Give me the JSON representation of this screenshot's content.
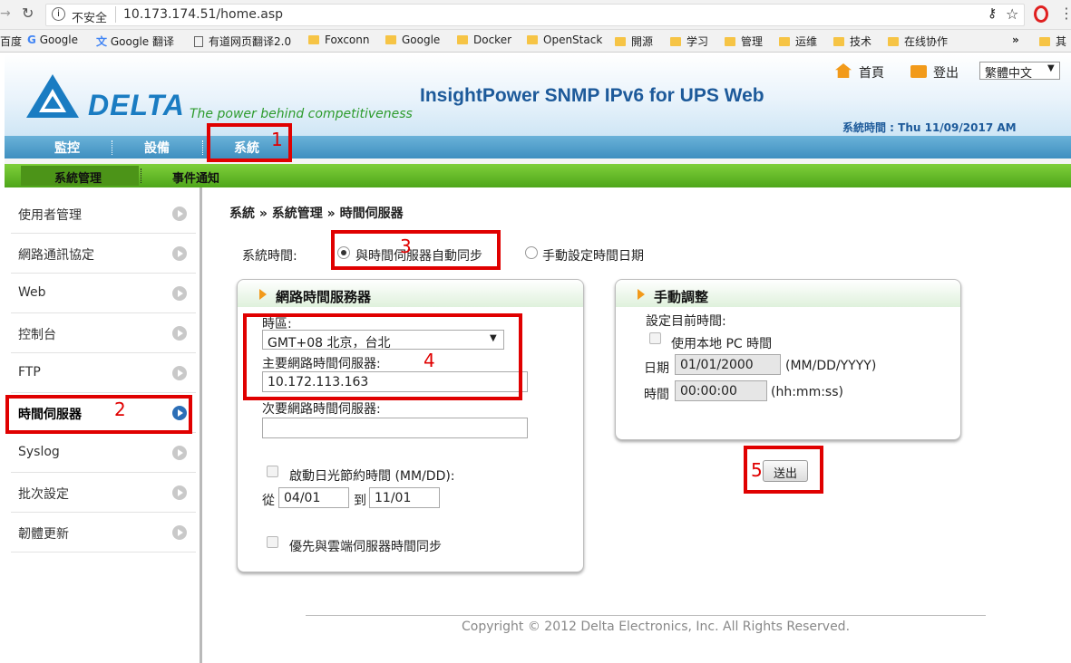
{
  "browser": {
    "security_label": "不安全",
    "url": "10.173.174.51/home.asp",
    "bookmarks": [
      "Google",
      "Google 翻译",
      "有道网页翻译2.0",
      "Foxconn",
      "Google",
      "Docker",
      "OpenStack",
      "開源",
      "学习",
      "管理",
      "运维",
      "技术",
      "在线协作"
    ],
    "bookmark_left_fragment": "百度",
    "bookmark_right_fragment": "其",
    "overflow": "»"
  },
  "header": {
    "brand": "DELTA",
    "tagline": "The power behind competitiveness",
    "title": "InsightPower SNMP IPv6 for UPS Web",
    "home_label": "首頁",
    "logout_label": "登出",
    "language": "繁體中文",
    "system_time": "系統時間 : Thu 11/09/2017 AM 08:34:28"
  },
  "nav": {
    "items": [
      "監控",
      "設備",
      "系統"
    ]
  },
  "subnav": {
    "items": [
      "系統管理",
      "事件通知"
    ]
  },
  "sidebar": {
    "items": [
      "使用者管理",
      "網路通訊協定",
      "Web",
      "控制台",
      "FTP",
      "時間伺服器",
      "Syslog",
      "批次設定",
      "韌體更新"
    ]
  },
  "breadcrumb": "系統 » 系統管理 » 時間伺服器",
  "system_time_section": {
    "label": "系統時間:",
    "option_auto": "與時間伺服器自動同步",
    "option_manual": "手動設定時間日期"
  },
  "ntp_panel": {
    "title": "網路時間服務器",
    "timezone_label": "時區:",
    "timezone_value": "GMT+08 北京，台北",
    "primary_label": "主要網路時間伺服器:",
    "primary_value": "10.172.113.163",
    "secondary_label": "次要網路時間伺服器:",
    "secondary_value": "",
    "dst_label": "啟動日光節約時間 (MM/DD):",
    "from_label": "從",
    "from_value": "04/01",
    "to_label": "到",
    "to_value": "11/01",
    "cloud_sync_label": "優先與雲端伺服器時間同步"
  },
  "manual_panel": {
    "title": "手動調整",
    "set_label": "設定目前時間:",
    "use_pc_label": "使用本地 PC 時間",
    "date_label": "日期",
    "date_value": "01/01/2000",
    "date_format": "(MM/DD/YYYY)",
    "time_label": "時間",
    "time_value": "00:00:00",
    "time_format": "(hh:mm:ss)"
  },
  "submit_label": "送出",
  "footer": "Copyright © 2012 Delta Electronics, Inc. All Rights Reserved.",
  "annotations": [
    "1",
    "2",
    "3",
    "4",
    "5"
  ],
  "colors": {
    "annotation_red": "#e00000",
    "nav_blue": "#4a9bc9",
    "subnav_green": "#5cb224",
    "title_blue": "#1d5a9a"
  }
}
